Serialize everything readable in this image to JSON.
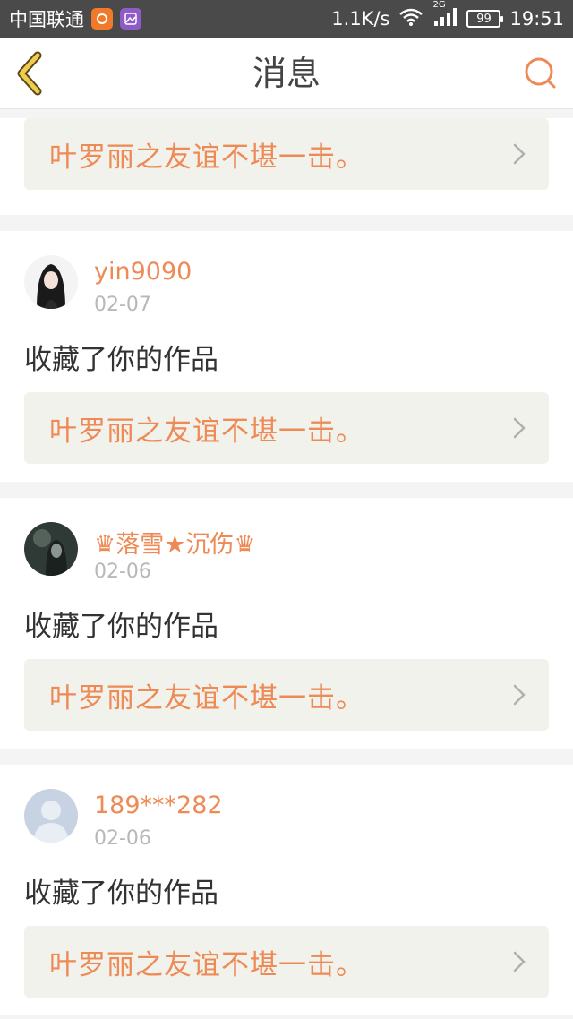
{
  "status_bar": {
    "carrier": "中国联通",
    "speed": "1.1K/s",
    "network": "2G",
    "battery": "99",
    "time": "19:51"
  },
  "header": {
    "title": "消息"
  },
  "feed": {
    "partial_item": {
      "work_title": "叶罗丽之友谊不堪一击。"
    },
    "items": [
      {
        "username": "yin9090",
        "date": "02-07",
        "action": "收藏了你的作品",
        "work_title": "叶罗丽之友谊不堪一击。"
      },
      {
        "username": "♛落雪★沉伤♛",
        "date": "02-06",
        "action": "收藏了你的作品",
        "work_title": "叶罗丽之友谊不堪一击。"
      },
      {
        "username": "189***282",
        "date": "02-06",
        "action": "收藏了你的作品",
        "work_title": "叶罗丽之友谊不堪一击。"
      }
    ]
  },
  "colors": {
    "accent": "#ee8a55",
    "back_icon": "#e6c24a",
    "status_bar": "#4a4a4a",
    "work_bg": "#f2f2ec"
  },
  "icons": [
    "back-arrow-icon",
    "search-icon",
    "chevron-right-icon",
    "wifi-icon",
    "signal-icon",
    "battery-icon"
  ]
}
